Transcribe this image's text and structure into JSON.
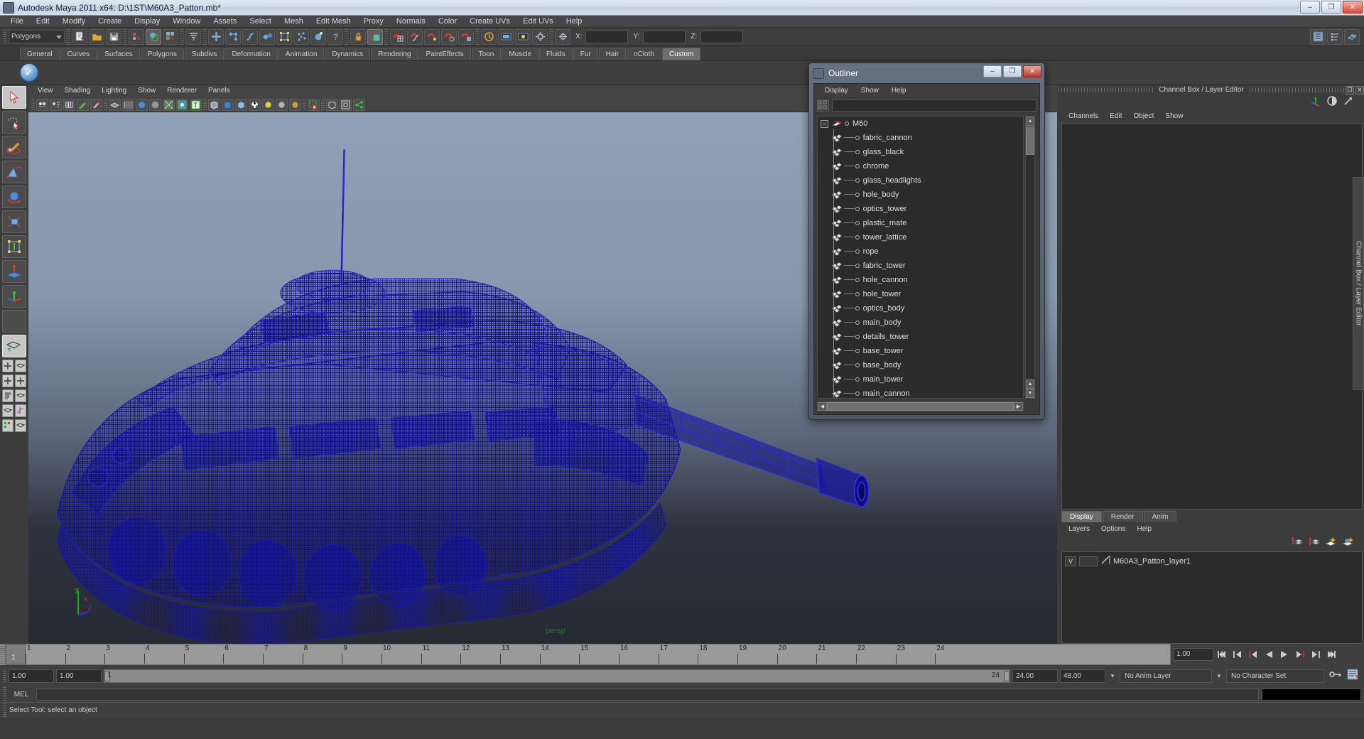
{
  "window": {
    "title": "Autodesk Maya 2011 x64: D:\\1ST\\M60A3_Patton.mb*",
    "app_icon": "maya-icon",
    "minimize": "–",
    "maximize": "❐",
    "close": "✕"
  },
  "menubar": {
    "items": [
      "File",
      "Edit",
      "Modify",
      "Create",
      "Display",
      "Window",
      "Assets",
      "Select",
      "Mesh",
      "Edit Mesh",
      "Proxy",
      "Normals",
      "Color",
      "Create UVs",
      "Edit UVs",
      "Help"
    ]
  },
  "statusline": {
    "mode_selector": "Polygons",
    "x_label": "X:",
    "y_label": "Y:",
    "z_label": "Z:",
    "x_value": "",
    "y_value": "",
    "z_value": ""
  },
  "shelf": {
    "tabs": [
      "General",
      "Curves",
      "Surfaces",
      "Polygons",
      "Subdivs",
      "Deformation",
      "Animation",
      "Dynamics",
      "Rendering",
      "PaintEffects",
      "Toon",
      "Muscle",
      "Fluids",
      "Fur",
      "Hair",
      "nCloth",
      "Custom"
    ],
    "active_tab": "Custom",
    "item_icon": "blue-check-sphere-icon"
  },
  "viewport": {
    "menu": [
      "View",
      "Shading",
      "Lighting",
      "Show",
      "Renderer",
      "Panels"
    ],
    "camera_label": "persp",
    "axis_x": "x",
    "axis_y": "y",
    "axis_z": "z",
    "model_color": "#1a1a9c"
  },
  "outliner": {
    "title": "Outliner",
    "minimize": "–",
    "maximize": "❐",
    "close": "✕",
    "menu": [
      "Display",
      "Show",
      "Help"
    ],
    "search_value": "",
    "root": "M60",
    "expand_glyph": "–",
    "items": [
      "fabric_cannon",
      "glass_black",
      "chrome",
      "glass_headlights",
      "hole_body",
      "optics_tower",
      "plastic_mate",
      "tower_lattice",
      "rope",
      "fabric_tower",
      "hole_cannon",
      "hole_tower",
      "optics_body",
      "main_body",
      "details_tower",
      "base_tower",
      "base_body",
      "main_tower",
      "main_cannon"
    ]
  },
  "channelbox": {
    "title": "Channel Box / Layer Editor",
    "menu": [
      "Channels",
      "Edit",
      "Object",
      "Show"
    ],
    "side_tab": "Channel Box / Layer Editor",
    "restore_glyph": "❐",
    "close_glyph": "✕"
  },
  "layer_editor": {
    "tabs": [
      "Display",
      "Render",
      "Anim"
    ],
    "active_tab": "Display",
    "menu": [
      "Layers",
      "Options",
      "Help"
    ],
    "layers": [
      {
        "visible": "V",
        "name": "M60A3_Patton_layer1"
      }
    ]
  },
  "timeline": {
    "ticks": [
      "1",
      "2",
      "3",
      "4",
      "5",
      "6",
      "7",
      "8",
      "9",
      "10",
      "11",
      "12",
      "13",
      "14",
      "15",
      "16",
      "17",
      "18",
      "19",
      "20",
      "21",
      "22",
      "23",
      "24"
    ],
    "current_frame": "1",
    "current_frame_field": "1.00",
    "playback_buttons": [
      "⏮",
      "⏴|",
      "|◀",
      "◀",
      "▶",
      "▶|",
      "▶|",
      "⏭"
    ]
  },
  "range": {
    "start": "1.00",
    "start_alt": "1.00",
    "slider_left": "1",
    "slider_right": "24",
    "end": "24.00",
    "end_max": "48.00",
    "anim_layer": "No Anim Layer",
    "character_set": "No Character Set"
  },
  "mel": {
    "label": "MEL",
    "value": "",
    "output": ""
  },
  "statusbar": {
    "message": "Select Tool: select an object"
  }
}
